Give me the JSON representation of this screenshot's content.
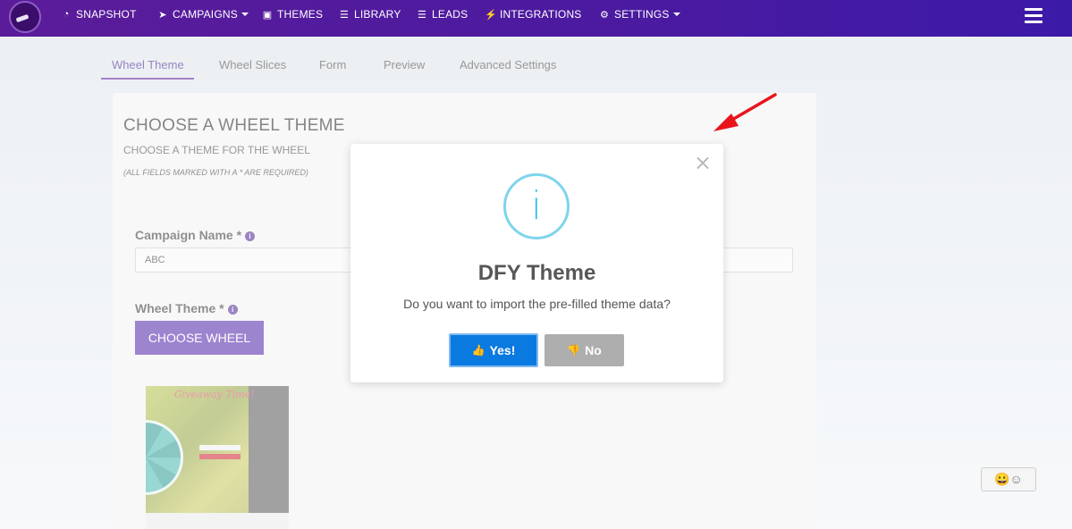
{
  "nav": {
    "items": [
      {
        "label": "SNAPSHOT",
        "icon": "dashboard-icon",
        "glyph": "◔"
      },
      {
        "label": "CAMPAIGNS",
        "icon": "paper-plane-icon",
        "glyph": "➤"
      },
      {
        "label": "THEMES",
        "icon": "image-icon",
        "glyph": "▣"
      },
      {
        "label": "LIBRARY",
        "icon": "list-icon",
        "glyph": "☰"
      },
      {
        "label": "LEADS",
        "icon": "list-icon",
        "glyph": "☰"
      },
      {
        "label": "INTEGRATIONS",
        "icon": "plug-icon",
        "glyph": "⚡"
      },
      {
        "label": "SETTINGS",
        "icon": "gears-icon",
        "glyph": "⚙"
      }
    ]
  },
  "tabs": [
    "Wheel Theme",
    "Wheel Slices",
    "Form",
    "Preview",
    "Advanced Settings"
  ],
  "active_tab": "Wheel Theme",
  "card": {
    "title": "CHOOSE A WHEEL THEME",
    "subtitle": "CHOOSE A THEME FOR THE WHEEL",
    "note": "(ALL FIELDS MARKED WITH A * ARE REQUIRED)",
    "campaign_label": "Campaign Name *",
    "campaign_value": "ABC",
    "wheel_label": "Wheel Theme *",
    "choose_button": "CHOOSE WHEEL",
    "thumb_text": "Giveaway Time!"
  },
  "modal": {
    "title": "DFY Theme",
    "message": "Do you want to import the pre-filled theme data?",
    "yes_label": "Yes!",
    "no_label": "No",
    "info_glyph": "i",
    "close_glyph": "×"
  },
  "colors": {
    "nav_start": "#5b1c9a",
    "nav_end": "#3c1aa8",
    "accent": "#4e1fa8",
    "yes_button": "#0b7ae0",
    "no_button": "#aeaeae",
    "info_ring": "#7fd4ec",
    "annotation_arrow": "#e8141a"
  }
}
